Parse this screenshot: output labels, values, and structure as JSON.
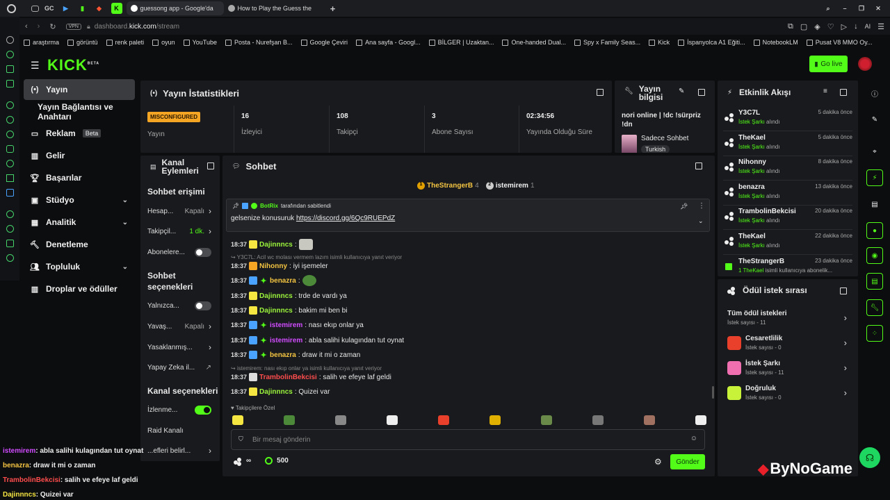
{
  "browser": {
    "tabs": [
      {
        "label": "guessong app - Google'da",
        "active": true
      },
      {
        "label": "How to Play the Guess the",
        "active": false
      }
    ],
    "pinned_labels": [
      "GC"
    ],
    "url_prefix": "VPN",
    "url_host": "dashboard.",
    "url_bold": "kick.com",
    "url_path": "/stream",
    "ai_label": "AI",
    "bookmarks": [
      "araştırma",
      "görüntü",
      "renk paleti",
      "oyun",
      "YouTube",
      "Posta - Nurefşan B...",
      "Google Çeviri",
      "Ana sayfa - Googl...",
      "BİLGER | Uzaktan...",
      "One-handed Dual...",
      "Spy x Family Seas...",
      "Kick",
      "İspanyolca A1 Eğiti...",
      "NotebookLM",
      "Pusat V8 MMO Oy..."
    ]
  },
  "header": {
    "logo": "KICK",
    "logo_badge": "BETA",
    "go_live": "Go live"
  },
  "nav": {
    "items": [
      {
        "label": "Yayın"
      },
      {
        "label": "Yayın Bağlantısı ve Anahtarı"
      },
      {
        "label": "Reklam",
        "badge": "Beta"
      },
      {
        "label": "Gelir"
      },
      {
        "label": "Başarılar"
      },
      {
        "label": "Stüdyo"
      },
      {
        "label": "Analitik"
      },
      {
        "label": "Denetleme"
      },
      {
        "label": "Topluluk"
      },
      {
        "label": "Droplar ve ödüller"
      }
    ]
  },
  "stats": {
    "title": "Yayın İstatistikleri",
    "status_badge": "MISCONFIGURED",
    "status_label": "Yayın",
    "cells": [
      {
        "value": "16",
        "label": "İzleyici"
      },
      {
        "value": "108",
        "label": "Takipçi"
      },
      {
        "value": "3",
        "label": "Abone Sayısı"
      },
      {
        "value": "02:34:56",
        "label": "Yayında Olduğu Süre"
      }
    ]
  },
  "stream_info": {
    "title": "Yayın bilgisi",
    "stream_title": "nori online | !dc !sürpriz !dn",
    "category": "Sadece Sohbet",
    "tag": "Turkish"
  },
  "channel_actions": {
    "title": "Kanal Eylemleri",
    "chat_access_title": "Sohbet erişimi",
    "rows1": [
      {
        "label": "Hesap...",
        "value": "Kapalı"
      },
      {
        "label": "Takipçil...",
        "value": "1 dk."
      },
      {
        "label": "Abonelere..."
      }
    ],
    "chat_options_title": "Sohbet seçenekleri",
    "rows2": [
      {
        "label": "Yalnızca..."
      },
      {
        "label": "Yavaş...",
        "value": "Kapalı"
      },
      {
        "label": "Yasaklanmış..."
      },
      {
        "label": "Yapay Zeka il..."
      }
    ],
    "channel_options_title": "Kanal seçenekleri",
    "rows3": [
      {
        "label": "İzlenme..."
      },
      {
        "label": "Raid Kanalı"
      },
      {
        "label": "...efleri belirl..."
      }
    ]
  },
  "chat": {
    "title": "Sohbet",
    "top_gifters": [
      {
        "name": "TheStrangerB",
        "count": "4"
      },
      {
        "name": "istemirem",
        "count": "1"
      }
    ],
    "pinned": {
      "by": "BotRix",
      "by_suffix": "tarafından sabitlendi",
      "text": "gelsenize konusuruk",
      "link": "https://discord.gg/6Qc9RUEPdZ"
    },
    "messages": [
      {
        "time": "18:37",
        "user": "Dajinnncs",
        "text": ":",
        "color": "#9cf43c"
      },
      {
        "reply": "Y3C7L: Acil wc molası vermem lazım isimli kullanıcıya yanıt veriyor"
      },
      {
        "time": "18:37",
        "user": "Nihonny",
        "text": ": iyi işemeler",
        "color": "#f5c542"
      },
      {
        "time": "18:37",
        "user": "benazra",
        "text": ":",
        "color": "#f5c542"
      },
      {
        "time": "18:37",
        "user": "Dajinnncs",
        "text": ": trde de vardı ya",
        "color": "#9cf43c"
      },
      {
        "time": "18:37",
        "user": "Dajinnncs",
        "text": ": bakim mi ben bi",
        "color": "#9cf43c"
      },
      {
        "time": "18:37",
        "user": "istemirem",
        "text": ": nası ekıp onlar ya",
        "color": "#d14cff"
      },
      {
        "time": "18:37",
        "user": "istemirem",
        "text": ": abla salihi kulagından tut oynat",
        "color": "#d14cff"
      },
      {
        "time": "18:37",
        "user": "benazra",
        "text": ": draw it mi o zaman",
        "color": "#f5c542"
      },
      {
        "reply": "istemirem: nası ekıp onlar ya isimli kullanıcıya yanıt veriyor"
      },
      {
        "time": "18:37",
        "user": "TrambolinBekcisi",
        "text": ": salih ve efeye laf geldi",
        "color": "#ff4d4d"
      },
      {
        "time": "18:37",
        "user": "Dajinnncs",
        "text": ": Quizei var",
        "color": "#9cf43c"
      }
    ],
    "followers_only": "Takipçilere Özel",
    "input_placeholder": "Bir mesaj gönderin",
    "infinity": "∞",
    "points": "500",
    "send": "Gönder"
  },
  "activity": {
    "title": "Etkinlik Akışı",
    "items": [
      {
        "name": "Y3C7L",
        "time": "5 dakika önce",
        "action": "İstek Şarkı",
        "suffix": "alındı"
      },
      {
        "name": "TheKael",
        "time": "5 dakika önce",
        "action": "İstek Şarkı",
        "suffix": "alındı"
      },
      {
        "name": "Nihonny",
        "time": "8 dakika önce",
        "action": "İstek Şarkı",
        "suffix": "alındı"
      },
      {
        "name": "benazra",
        "time": "13 dakika önce",
        "action": "İstek Şarkı",
        "suffix": "alındı"
      },
      {
        "name": "TrambolinBekcisi",
        "time": "20 dakika önce",
        "action": "İstek Şarkı",
        "suffix": "alındı"
      },
      {
        "name": "TheKael",
        "time": "22 dakika önce",
        "action": "İstek Şarkı",
        "suffix": "alındı"
      },
      {
        "name": "TheStrangerB",
        "time": "23 dakika önce",
        "action": "1 TheKael",
        "suffix": "isimli kullanıcıya abonelik..."
      }
    ]
  },
  "rewards": {
    "title": "Ödül istek sırası",
    "all_label": "Tüm ödül istekleri",
    "all_count": "İstek sayısı - 11",
    "items": [
      {
        "name": "Cesaretlilik",
        "count": "İstek sayısı - 0",
        "color": "#e8402b"
      },
      {
        "name": "İstek Şarkı",
        "count": "İstek sayısı - 11",
        "color": "#f06fb0"
      },
      {
        "name": "Doğruluk",
        "count": "İstek sayısı - 0",
        "color": "#c8f23a"
      }
    ]
  },
  "overlay": {
    "lines": [
      {
        "user": "istemirem",
        "text": ": abla salihi kulagından tut oynat",
        "color": "#d14cff"
      },
      {
        "user": "benazra",
        "text": ": draw it mi o zaman",
        "color": "#f5c542"
      },
      {
        "user": "TrambolinBekcisi",
        "text": ": salih ve efeye laf geldi",
        "color": "#ff4d4d"
      },
      {
        "user": "Dajinnncs",
        "text": ": Quizei var",
        "color": "#f5e642"
      }
    ],
    "watermark": "ByNoGame"
  },
  "colors": {
    "accent": "#53fc18",
    "panel": "#181a1d",
    "bg": "#0c0d0f"
  }
}
